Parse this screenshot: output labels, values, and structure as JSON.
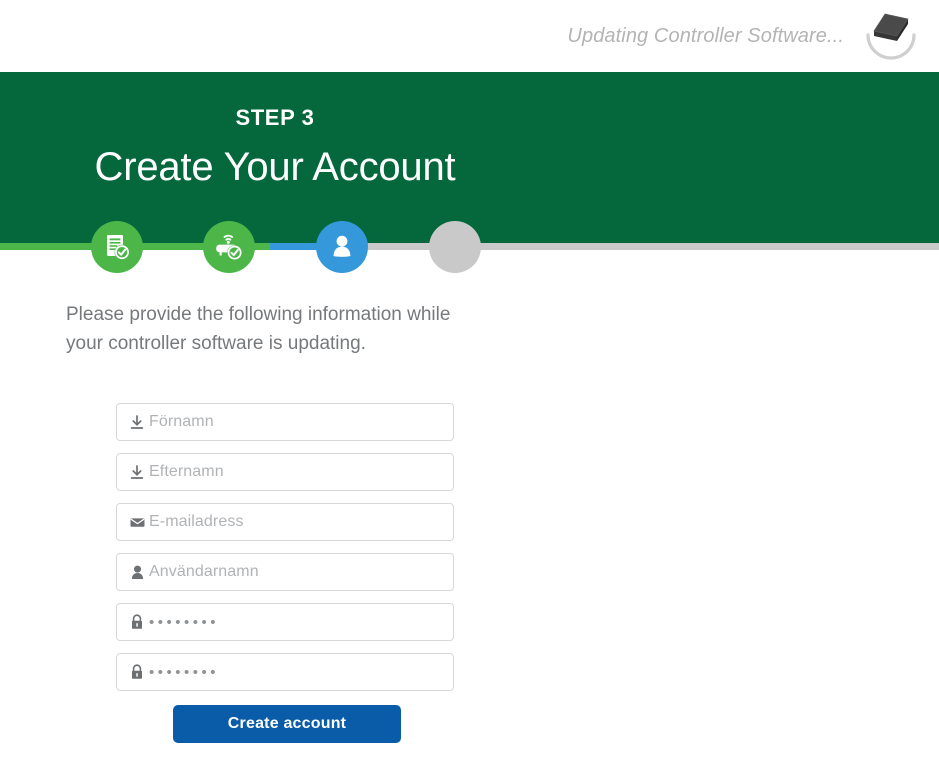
{
  "topbar": {
    "status_text": "Updating Controller Software...",
    "spinner_icon": "controller-device-spinner-icon"
  },
  "hero": {
    "step_label": "STEP 3",
    "title": "Create Your Account",
    "bg_color": "#04683c"
  },
  "stepper": {
    "steps": [
      {
        "name": "plan",
        "icon": "document-check-icon",
        "state": "complete",
        "color": "#4cb648"
      },
      {
        "name": "controller",
        "icon": "router-check-icon",
        "state": "complete",
        "color": "#4cb648"
      },
      {
        "name": "account",
        "icon": "user-icon",
        "state": "active",
        "color": "#3498db"
      },
      {
        "name": "finish",
        "icon": "empty-circle-icon",
        "state": "pending",
        "color": "#c9c9c9"
      }
    ]
  },
  "content": {
    "intro": "Please provide the following information while your controller software is updating."
  },
  "form": {
    "fields": [
      {
        "name": "first-name",
        "icon": "download-arrow-icon",
        "placeholder": "Förnamn",
        "value": "",
        "type": "text"
      },
      {
        "name": "last-name",
        "icon": "download-arrow-icon",
        "placeholder": "Efternamn",
        "value": "",
        "type": "text"
      },
      {
        "name": "email",
        "icon": "envelope-icon",
        "placeholder": "E-mailadress",
        "value": "",
        "type": "email"
      },
      {
        "name": "username",
        "icon": "person-icon",
        "placeholder": "Användarnamn",
        "value": "",
        "type": "text"
      },
      {
        "name": "password",
        "icon": "lock-icon",
        "placeholder": "",
        "value": "••••••••",
        "type": "password"
      },
      {
        "name": "password-confirm",
        "icon": "lock-icon",
        "placeholder": "",
        "value": "••••••••",
        "type": "password"
      }
    ],
    "submit_label": "Create account",
    "submit_color": "#0a5ca8"
  }
}
